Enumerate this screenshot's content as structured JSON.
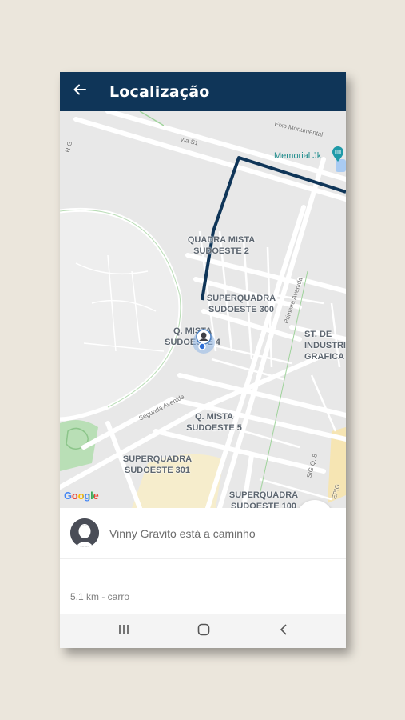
{
  "app_bar": {
    "title": "Localização",
    "background": "#0f3558",
    "back_icon": "arrow-left-icon"
  },
  "map": {
    "place_labels": [
      {
        "id": "qm2",
        "lines": [
          "QUADRA MISTA",
          "SUDOESTE 2"
        ]
      },
      {
        "id": "sq300",
        "lines": [
          "SUPERQUADRA",
          "SUDOESTE 300"
        ]
      },
      {
        "id": "qm4",
        "lines": [
          "Q. MISTA",
          "SUDOESTE 4"
        ]
      },
      {
        "id": "stde",
        "lines": [
          "ST. DE",
          "INDUSTRI",
          "GRAFICA"
        ]
      },
      {
        "id": "qm5",
        "lines": [
          "Q. MISTA",
          "SUDOESTE 5"
        ]
      },
      {
        "id": "sq301",
        "lines": [
          "SUPERQUADRA",
          "SUDOESTE 301"
        ]
      },
      {
        "id": "sq100",
        "lines": [
          "SUPERQUADRA",
          "SUDOESTE 100"
        ]
      }
    ],
    "road_labels": {
      "eixo": "Eixo Monumental",
      "via_s1": "Via S1",
      "primeira": "Primeira Avenida",
      "segunda": "Segunda Avenida",
      "sig": "SIG Q. 8",
      "epig": "EPIG",
      "r_g": "R G"
    },
    "poi": {
      "label": "Memorial Jk",
      "icon": "museum-pin-icon"
    },
    "route_color": "#0f3558",
    "attribution": "Google",
    "locate_icon": "my-location-icon"
  },
  "driver": {
    "status_text": "Vinny Gravito está a caminho",
    "avatar_icon": "avatar-icon"
  },
  "trip": {
    "distance_text": "5.1 km - carro"
  },
  "system_nav": {
    "recents_icon": "recents-icon",
    "home_icon": "home-icon",
    "back_icon": "back-chevron-icon"
  }
}
